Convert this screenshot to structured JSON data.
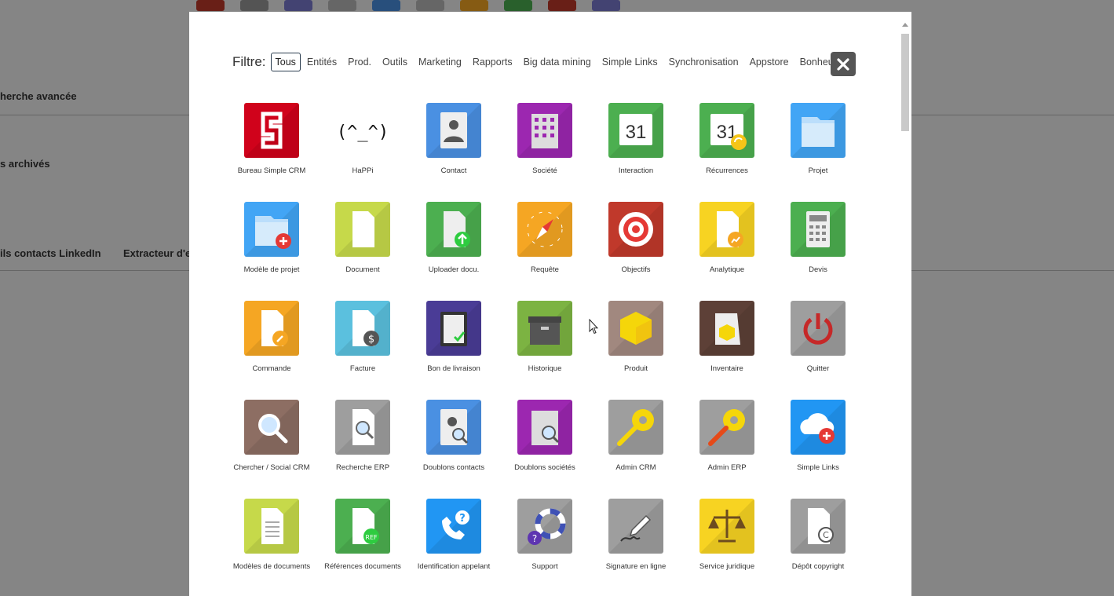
{
  "background": {
    "texts": [
      "herche avancée",
      "s archivés",
      "ils contacts LinkedIn",
      "Extracteur d'e"
    ]
  },
  "filter": {
    "label": "Filtre:",
    "items": [
      "Tous",
      "Entités",
      "Prod.",
      "Outils",
      "Marketing",
      "Rapports",
      "Big data mining",
      "Simple Links",
      "Synchronisation",
      "Appstore",
      "Bonheur"
    ],
    "active": "Tous"
  },
  "close_icon": "close-icon",
  "tiles": [
    {
      "label": "Bureau Simple CRM",
      "icon": "simple-crm-logo-icon",
      "color": "#d0021b"
    },
    {
      "label": "HaPPi",
      "icon": "happi-face-icon",
      "color": "#ffffff"
    },
    {
      "label": "Contact",
      "icon": "contact-card-icon",
      "color": "#4a90e2"
    },
    {
      "label": "Société",
      "icon": "building-icon",
      "color": "#9c27b0"
    },
    {
      "label": "Interaction",
      "icon": "calendar-icon",
      "color": "#4caf50"
    },
    {
      "label": "Récurrences",
      "icon": "calendar-recurring-icon",
      "color": "#4caf50"
    },
    {
      "label": "Projet",
      "icon": "folder-icon",
      "color": "#42a5f5"
    },
    {
      "label": "Modèle de projet",
      "icon": "folder-add-icon",
      "color": "#42a5f5"
    },
    {
      "label": "Document",
      "icon": "document-icon",
      "color": "#c6d94a"
    },
    {
      "label": "Uploader docu.",
      "icon": "document-upload-icon",
      "color": "#4caf50"
    },
    {
      "label": "Requête",
      "icon": "compass-icon",
      "color": "#f5a623"
    },
    {
      "label": "Objectifs",
      "icon": "target-icon",
      "color": "#c0392b"
    },
    {
      "label": "Analytique",
      "icon": "analytics-document-icon",
      "color": "#f7d322"
    },
    {
      "label": "Devis",
      "icon": "calculator-icon",
      "color": "#4caf50"
    },
    {
      "label": "Commande",
      "icon": "order-document-icon",
      "color": "#f5a623"
    },
    {
      "label": "Facture",
      "icon": "invoice-icon",
      "color": "#5bc0de"
    },
    {
      "label": "Bon de livraison",
      "icon": "clipboard-check-icon",
      "color": "#4a3c96"
    },
    {
      "label": "Historique",
      "icon": "archive-box-icon",
      "color": "#7cb342"
    },
    {
      "label": "Produit",
      "icon": "product-cube-icon",
      "color": "#a1887f"
    },
    {
      "label": "Inventaire",
      "icon": "inventory-icon",
      "color": "#5d4037"
    },
    {
      "label": "Quitter",
      "icon": "power-icon",
      "color": "#9e9e9e"
    },
    {
      "label": "Chercher / Social CRM",
      "icon": "search-icon",
      "color": "#8d6e63"
    },
    {
      "label": "Recherche ERP",
      "icon": "search-document-icon",
      "color": "#9e9e9e"
    },
    {
      "label": "Doublons contacts",
      "icon": "duplicate-contacts-icon",
      "color": "#4a90e2"
    },
    {
      "label": "Doublons sociétés",
      "icon": "duplicate-companies-icon",
      "color": "#9c27b0"
    },
    {
      "label": "Admin CRM",
      "icon": "gear-wrench-icon",
      "color": "#9e9e9e"
    },
    {
      "label": "Admin ERP",
      "icon": "gear-wrench-red-icon",
      "color": "#9e9e9e"
    },
    {
      "label": "Simple Links",
      "icon": "cloud-add-icon",
      "color": "#2196f3"
    },
    {
      "label": "Modèles de documents",
      "icon": "document-template-icon",
      "color": "#c6d94a"
    },
    {
      "label": "Références documents",
      "icon": "document-ref-icon",
      "color": "#4caf50"
    },
    {
      "label": "Identification appelant",
      "icon": "phone-question-icon",
      "color": "#2196f3"
    },
    {
      "label": "Support",
      "icon": "lifebuoy-icon",
      "color": "#9e9e9e"
    },
    {
      "label": "Signature en ligne",
      "icon": "pen-signature-icon",
      "color": "#9e9e9e"
    },
    {
      "label": "Service juridique",
      "icon": "scales-icon",
      "color": "#f7d322"
    },
    {
      "label": "Dépôt copyright",
      "icon": "copyright-document-icon",
      "color": "#9e9e9e"
    }
  ]
}
